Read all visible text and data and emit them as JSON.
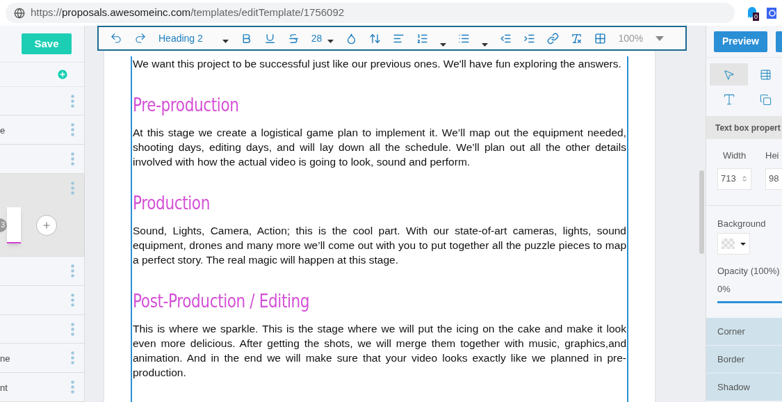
{
  "browser": {
    "url_scheme": "https://",
    "url_host": "proposals.awesomeinc.com",
    "url_path": "/templates/editTemplate/1756092",
    "extension_badge": "0"
  },
  "sidebar": {
    "save": "Save",
    "sections": [
      {
        "selected": false
      },
      {
        "selected": false,
        "label": "e"
      },
      {
        "selected": false
      },
      {
        "selected": true,
        "page_number": "3"
      },
      {
        "selected": false
      },
      {
        "selected": false
      },
      {
        "selected": false
      },
      {
        "selected": false,
        "label": "ne"
      },
      {
        "selected": false,
        "label": "nt"
      }
    ]
  },
  "toolbar": {
    "block_style": "Heading 2",
    "font_size": "28",
    "zoom": "100%"
  },
  "document": {
    "blocks": [
      {
        "kind": "paragraph",
        "text": "We want this project to be successful just like our previous ones. We'll have fun exploring the answers."
      },
      {
        "kind": "heading",
        "text": "Pre-production"
      },
      {
        "kind": "paragraph",
        "text": "At this stage we create a logistical game plan to implement it. We’ll map out the equipment needed, shooting days, editing days, and will lay down all the schedule. We’ll plan out all the other details involved with how the actual video is going to look, sound and perform."
      },
      {
        "kind": "heading",
        "text": "Production"
      },
      {
        "kind": "paragraph",
        "text": "Sound, Lights, Camera, Action; this is the cool part. With our state-of-art cameras, lights, sound equipment, drones and many more we’ll come out with you to put together all the puzzle pieces to map a perfect story. The real magic will happen at this stage."
      },
      {
        "kind": "heading",
        "text": "Post-Production / Editing"
      },
      {
        "kind": "paragraph",
        "text": "This is where we sparkle. This is the stage where we will put the icing on the cake and make it look even more delicious. After getting the shots, we will merge them together with music, graphics,and animation. And in the end we will make sure that your video looks exactly like we planned in pre-production."
      }
    ]
  },
  "right_panel": {
    "preview": "Preview",
    "tools": [
      {
        "kind": "pointer",
        "selected": true
      },
      {
        "kind": "table",
        "selected": false
      },
      {
        "kind": "text",
        "selected": false
      },
      {
        "kind": "copy",
        "selected": false
      }
    ],
    "section_title": "Text box propert",
    "width_label": "Width",
    "width_value": "713",
    "height_label": "Hei",
    "height_value": "98",
    "background_label": "Background",
    "opacity_label": "Opacity (100%)",
    "opacity_value": "0%",
    "opacity_slider": {
      "level": 1
    },
    "accordions": [
      "Corner",
      "Border",
      "Shadow"
    ]
  }
}
